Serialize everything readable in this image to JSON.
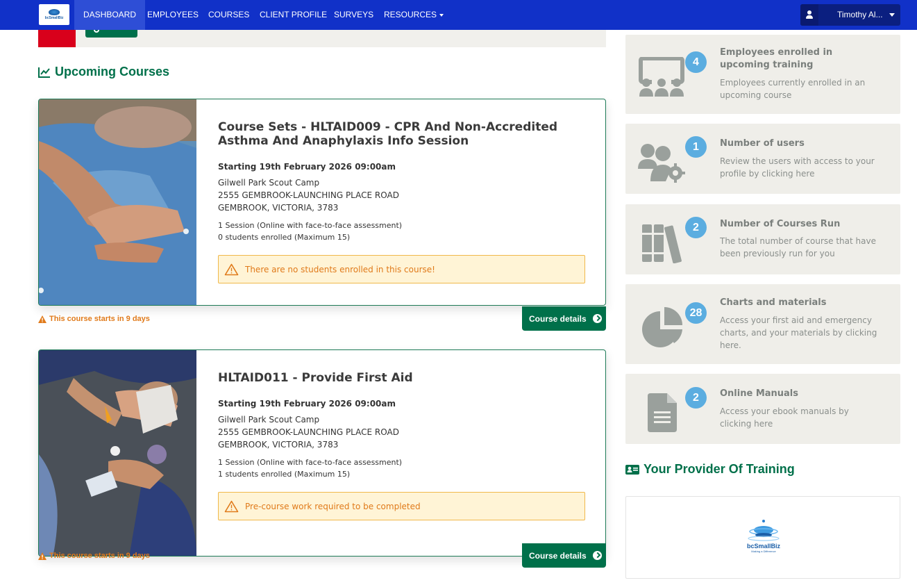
{
  "nav": {
    "logo_text": "bcSmallBiz",
    "items": [
      "DASHBOARD",
      "EMPLOYEES",
      "COURSES",
      "CLIENT PROFILE",
      "SURVEYS",
      "RESOURCES"
    ],
    "user_name": "Timothy Al..."
  },
  "upcoming": {
    "title": "Upcoming Courses",
    "courses": [
      {
        "title": "Course Sets - HLTAID009 - CPR And Non-Accredited Asthma And Anaphylaxis Info Session",
        "start": "Starting 19th February 2026 09:00am",
        "venue": "Gilwell Park Scout Camp",
        "address1": "2555 GEMBROOK-LAUNCHING PLACE ROAD",
        "address2": "GEMBROOK, VICTORIA, 3783",
        "sessions": "1 Session (Online with face-to-face assessment)",
        "enrolled": "0 students enrolled (Maximum 15)",
        "alert": "There are no students enrolled in this course!",
        "warning": "This course starts in 9 days",
        "details_label": "Course details"
      },
      {
        "title": "HLTAID011 - Provide First Aid",
        "start": "Starting 19th February 2026 09:00am",
        "venue": "Gilwell Park Scout Camp",
        "address1": "2555 GEMBROOK-LAUNCHING PLACE ROAD",
        "address2": "GEMBROOK, VICTORIA, 3783",
        "sessions": "1 Session (Online with face-to-face assessment)",
        "enrolled": "1 students enrolled (Maximum 15)",
        "alert": "Pre-course work required to be completed",
        "warning": "This course starts in 9 days",
        "details_label": "Course details"
      }
    ]
  },
  "stats": [
    {
      "count": "4",
      "title": "Employees enrolled in upcoming training",
      "desc": "Employees currently enrolled in an upcoming course",
      "icon": "classroom-icon"
    },
    {
      "count": "1",
      "title": "Number of users",
      "desc": "Review the users with access to your profile by clicking here",
      "icon": "users-cog-icon"
    },
    {
      "count": "2",
      "title": "Number of Courses Run",
      "desc": "The total number of course that have been previously run for you",
      "icon": "books-icon"
    },
    {
      "count": "28",
      "title": "Charts and materials",
      "desc": "Access your first aid and emergency charts, and your materials by clicking here.",
      "icon": "pie-chart-icon"
    },
    {
      "count": "2",
      "title": "Online Manuals",
      "desc": "Access your ebook manuals by clicking here",
      "icon": "document-icon"
    }
  ],
  "provider": {
    "title": "Your Provider Of Training",
    "logo_text": "bcSmallBiz",
    "logo_tagline": "Making a Difference"
  },
  "colors": {
    "nav_bg": "#1131c8",
    "brand_green": "#00704a",
    "badge_blue": "#5bade0",
    "warning_orange": "#e07a1a"
  }
}
